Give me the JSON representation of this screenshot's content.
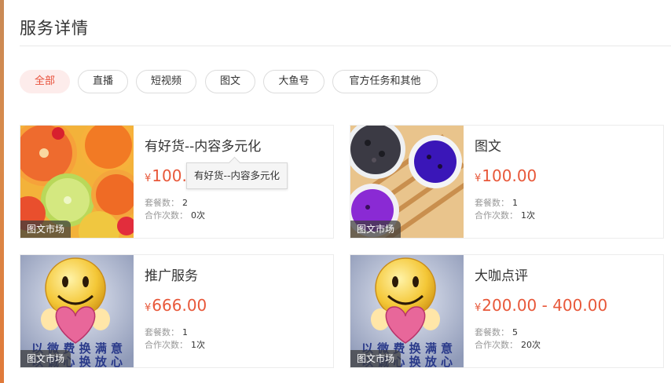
{
  "page": {
    "title": "服务详情"
  },
  "filters": [
    {
      "label": "全部",
      "active": true
    },
    {
      "label": "直播",
      "active": false
    },
    {
      "label": "短视频",
      "active": false
    },
    {
      "label": "图文",
      "active": false
    },
    {
      "label": "大鱼号",
      "active": false
    },
    {
      "label": "官方任务和其他",
      "active": false
    }
  ],
  "currency": "¥",
  "meta_labels": {
    "packages": "套餐数：",
    "cooperations": "合作次数："
  },
  "cards": [
    {
      "tag": "图文市场",
      "title": "有好货--内容多元化",
      "price": "100.00",
      "packages": "2",
      "cooperations": "0次",
      "image": "citrus-fruits"
    },
    {
      "tag": "图文市场",
      "title": "图文",
      "price": "100.00",
      "packages": "1",
      "cooperations": "1次",
      "image": "purple-tea"
    },
    {
      "tag": "图文市场",
      "title": "推广服务",
      "price": "666.00",
      "packages": "1",
      "cooperations": "1次",
      "image": "smiley-heart"
    },
    {
      "tag": "图文市场",
      "title": "大咖点评",
      "price": "200.00 - 400.00",
      "packages": "5",
      "cooperations": "20次",
      "image": "smiley-heart"
    }
  ],
  "tooltip": {
    "text": "有好货--内容多元化"
  },
  "smiley_caption": {
    "line1": "以 微 费 换 满 意",
    "line2": "以 诚 心 换 放 心"
  }
}
